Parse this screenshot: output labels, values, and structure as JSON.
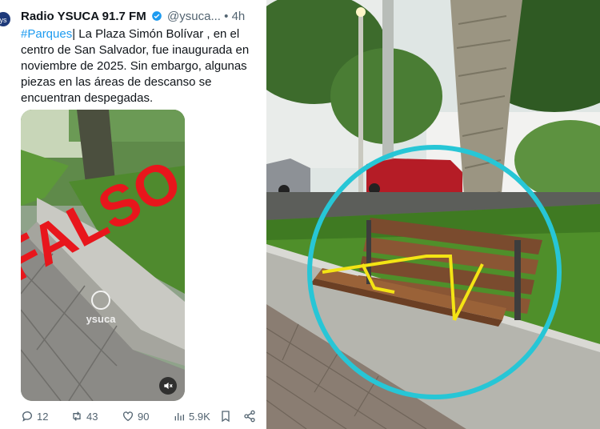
{
  "tweet": {
    "author_name": "Radio YSUCA 91.7 FM",
    "handle": "@ysuca...",
    "time": "4h",
    "hashtag": "#Parques",
    "text": "| La Plaza Simón Bolívar , en el centro de San Salvador, fue inaugurada en noviembre de 2025. Sin embargo, algunas piezas en las áreas de descanso se encuentran despegadas.",
    "stamp": "FALSO",
    "watermark": "ysuca",
    "counts": {
      "replies": "12",
      "retweets": "43",
      "likes": "90",
      "views": "5.9K"
    }
  },
  "colors": {
    "link": "#1d9bf0",
    "stamp": "#e8161c",
    "circle": "#27c6d6",
    "tape": "#f4e414"
  },
  "icons": [
    "verified-icon",
    "reply-icon",
    "retweet-icon",
    "like-icon",
    "views-icon",
    "bookmark-icon",
    "share-icon",
    "mute-icon"
  ]
}
